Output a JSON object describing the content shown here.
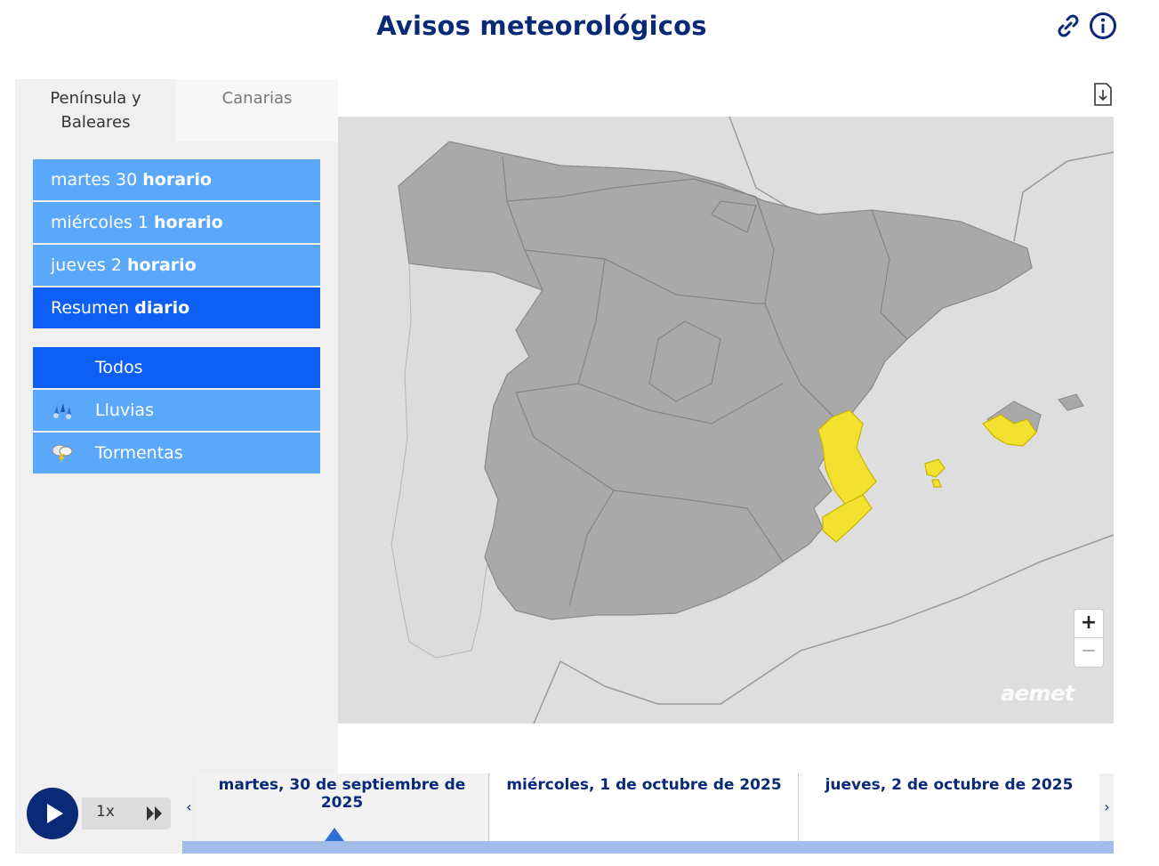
{
  "header": {
    "title": "Avisos meteorológicos",
    "link_icon": "link-icon",
    "info_icon": "info-icon"
  },
  "tabs": [
    {
      "label": "Península y Baleares",
      "active": true
    },
    {
      "label": "Canarias",
      "active": false
    }
  ],
  "days_menu": [
    {
      "prefix": "martes 30",
      "suffix": "horario",
      "selected": false
    },
    {
      "prefix": "miércoles 1",
      "suffix": "horario",
      "selected": false
    },
    {
      "prefix": "jueves 2",
      "suffix": "horario",
      "selected": false
    },
    {
      "prefix": "Resumen",
      "suffix": "diario",
      "selected": true
    }
  ],
  "filters": [
    {
      "label": "Todos",
      "icon": "",
      "selected": true
    },
    {
      "label": "Lluvias",
      "icon": "rain-icon",
      "selected": false
    },
    {
      "label": "Tormentas",
      "icon": "storm-icon",
      "selected": false
    }
  ],
  "map": {
    "zoom_in": "+",
    "zoom_out": "−",
    "logo": "aemet",
    "colors": {
      "background": "#dedede",
      "land": "#a9a9a9",
      "warning_yellow": "#f2e22f"
    }
  },
  "player": {
    "speed": "1x"
  },
  "timeline": {
    "prev": "‹",
    "next": "›",
    "days": [
      "martes, 30 de septiembre de 2025",
      "miércoles, 1 de octubre de 2025",
      "jueves, 2 de octubre de 2025"
    ]
  }
}
